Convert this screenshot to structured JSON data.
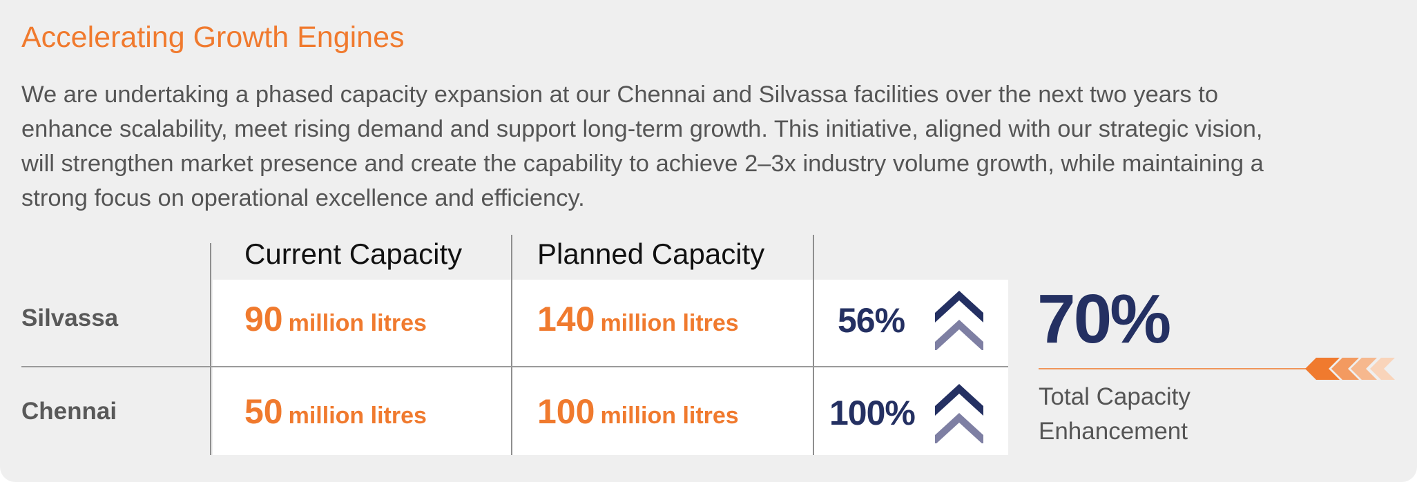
{
  "title": "Accelerating Growth Engines",
  "description": [
    "We are undertaking a phased capacity expansion at our Chennai and Silvassa facilities over the next two years to",
    "enhance scalability, meet rising demand and support long-term growth. This initiative, aligned with our strategic vision,",
    "will strengthen market presence and create the capability to achieve 2–3x industry volume growth, while maintaining a",
    "strong focus on operational excellence and efficiency."
  ],
  "table": {
    "headers": {
      "current": "Current Capacity",
      "planned": "Planned Capacity"
    },
    "rows": [
      {
        "facility": "Silvassa",
        "current_value": "90",
        "current_unit": "million litres",
        "planned_value": "140",
        "planned_unit": "million litres",
        "increase": "56%"
      },
      {
        "facility": "Chennai",
        "current_value": "50",
        "current_unit": "million litres",
        "planned_value": "100",
        "planned_unit": "million litres",
        "increase": "100%"
      }
    ]
  },
  "summary": {
    "value": "70%",
    "label_line1": "Total Capacity",
    "label_line2": "Enhancement"
  },
  "colors": {
    "accent_orange": "#f07a2e",
    "navy": "#243062",
    "chevron_light": "#7e7fa3",
    "background": "#efefef"
  },
  "icons": [
    "double-chevron-up-icon",
    "arrow-chevrons-left-icon"
  ]
}
